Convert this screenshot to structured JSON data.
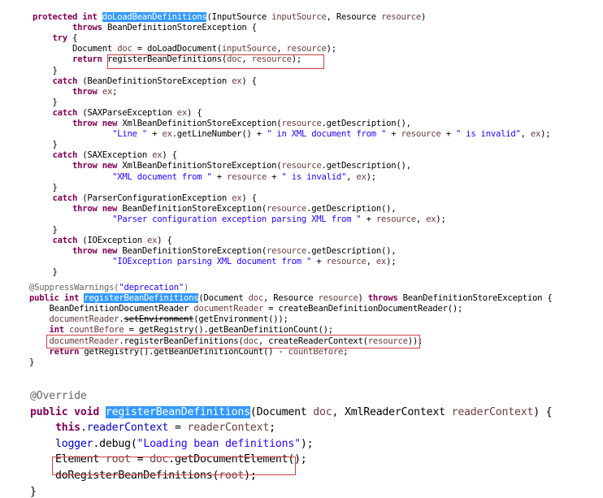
{
  "block1": {
    "lines": [
      [
        [
          "kw",
          "protected int "
        ],
        [
          "sel",
          "doLoadBeanDefinitions"
        ],
        [
          "",
          "(InputSource "
        ],
        [
          "var",
          "inputSource"
        ],
        [
          "",
          ", Resource "
        ],
        [
          "var",
          "resource"
        ],
        [
          "",
          ")"
        ]
      ],
      [
        [
          "",
          "        "
        ],
        [
          "kw",
          "throws"
        ],
        [
          "",
          " BeanDefinitionStoreException {"
        ]
      ],
      [
        [
          "",
          "    "
        ],
        [
          "kw",
          "try"
        ],
        [
          "",
          " {"
        ]
      ],
      [
        [
          "",
          "        Document "
        ],
        [
          "var",
          "doc"
        ],
        [
          "",
          " = doLoadDocument("
        ],
        [
          "var",
          "inputSource"
        ],
        [
          "",
          ", "
        ],
        [
          "var",
          "resource"
        ],
        [
          "",
          ");"
        ]
      ],
      [
        [
          "",
          "        "
        ],
        [
          "kw",
          "return"
        ],
        [
          "",
          " registerBeanDefinitions("
        ],
        [
          "var",
          "doc"
        ],
        [
          "",
          ", "
        ],
        [
          "var",
          "resource"
        ],
        [
          "",
          ");"
        ]
      ],
      [
        [
          "",
          "    }"
        ]
      ],
      [
        [
          "",
          "    "
        ],
        [
          "kw",
          "catch"
        ],
        [
          "",
          " (BeanDefinitionStoreException "
        ],
        [
          "var",
          "ex"
        ],
        [
          "",
          ") {"
        ]
      ],
      [
        [
          "",
          "        "
        ],
        [
          "kw",
          "throw"
        ],
        [
          "",
          " "
        ],
        [
          "var",
          "ex"
        ],
        [
          "",
          ";"
        ]
      ],
      [
        [
          "",
          "    }"
        ]
      ],
      [
        [
          "",
          "    "
        ],
        [
          "kw",
          "catch"
        ],
        [
          "",
          " (SAXParseException "
        ],
        [
          "var",
          "ex"
        ],
        [
          "",
          ") {"
        ]
      ],
      [
        [
          "",
          "        "
        ],
        [
          "kw",
          "throw new"
        ],
        [
          "",
          " XmlBeanDefinitionStoreException("
        ],
        [
          "var",
          "resource"
        ],
        [
          "",
          ".getDescription(),"
        ]
      ],
      [
        [
          "",
          "                "
        ],
        [
          "str",
          "\"Line \""
        ],
        [
          "",
          " + "
        ],
        [
          "var",
          "ex"
        ],
        [
          "",
          ".getLineNumber() + "
        ],
        [
          "str",
          "\" in XML document from \""
        ],
        [
          "",
          " + "
        ],
        [
          "var",
          "resource"
        ],
        [
          "",
          " + "
        ],
        [
          "str",
          "\" is invalid\""
        ],
        [
          "",
          ", "
        ],
        [
          "var",
          "ex"
        ],
        [
          "",
          ");"
        ]
      ],
      [
        [
          "",
          "    }"
        ]
      ],
      [
        [
          "",
          "    "
        ],
        [
          "kw",
          "catch"
        ],
        [
          "",
          " (SAXException "
        ],
        [
          "var",
          "ex"
        ],
        [
          "",
          ") {"
        ]
      ],
      [
        [
          "",
          "        "
        ],
        [
          "kw",
          "throw new"
        ],
        [
          "",
          " XmlBeanDefinitionStoreException("
        ],
        [
          "var",
          "resource"
        ],
        [
          "",
          ".getDescription(),"
        ]
      ],
      [
        [
          "",
          "                "
        ],
        [
          "str",
          "\"XML document from \""
        ],
        [
          "",
          " + "
        ],
        [
          "var",
          "resource"
        ],
        [
          "",
          " + "
        ],
        [
          "str",
          "\" is invalid\""
        ],
        [
          "",
          ", "
        ],
        [
          "var",
          "ex"
        ],
        [
          "",
          ");"
        ]
      ],
      [
        [
          "",
          "    }"
        ]
      ],
      [
        [
          "",
          "    "
        ],
        [
          "kw",
          "catch"
        ],
        [
          "",
          " (ParserConfigurationException "
        ],
        [
          "var",
          "ex"
        ],
        [
          "",
          ") {"
        ]
      ],
      [
        [
          "",
          "        "
        ],
        [
          "kw",
          "throw new"
        ],
        [
          "",
          " BeanDefinitionStoreException("
        ],
        [
          "var",
          "resource"
        ],
        [
          "",
          ".getDescription(),"
        ]
      ],
      [
        [
          "",
          "                "
        ],
        [
          "str",
          "\"Parser configuration exception parsing XML from \""
        ],
        [
          "",
          " + "
        ],
        [
          "var",
          "resource"
        ],
        [
          "",
          ", "
        ],
        [
          "var",
          "ex"
        ],
        [
          "",
          ");"
        ]
      ],
      [
        [
          "",
          "    }"
        ]
      ],
      [
        [
          "",
          "    "
        ],
        [
          "kw",
          "catch"
        ],
        [
          "",
          " (IOException "
        ],
        [
          "var",
          "ex"
        ],
        [
          "",
          ") {"
        ]
      ],
      [
        [
          "",
          "        "
        ],
        [
          "kw",
          "throw new"
        ],
        [
          "",
          " BeanDefinitionStoreException("
        ],
        [
          "var",
          "resource"
        ],
        [
          "",
          ".getDescription(),"
        ]
      ],
      [
        [
          "",
          "                "
        ],
        [
          "str",
          "\"IOException parsing XML document from \""
        ],
        [
          "",
          " + "
        ],
        [
          "var",
          "resource"
        ],
        [
          "",
          ", "
        ],
        [
          "var",
          "ex"
        ],
        [
          "",
          ");"
        ]
      ],
      [
        [
          "",
          "    }"
        ]
      ]
    ]
  },
  "block2": {
    "lines": [
      [
        [
          "ann",
          "@SuppressWarnings("
        ],
        [
          "str",
          "\"deprecation\""
        ],
        [
          "ann",
          ")"
        ]
      ],
      [
        [
          "kw",
          "public int "
        ],
        [
          "sel",
          "registerBeanDefinitions"
        ],
        [
          "",
          "(Document "
        ],
        [
          "var",
          "doc"
        ],
        [
          "",
          ", Resource "
        ],
        [
          "var",
          "resource"
        ],
        [
          "",
          ") "
        ],
        [
          "kw",
          "throws"
        ],
        [
          "",
          " BeanDefinitionStoreException {"
        ]
      ],
      [
        [
          "",
          "    BeanDefinitionDocumentReader "
        ],
        [
          "var",
          "documentReader"
        ],
        [
          "",
          " = createBeanDefinitionDocumentReader();"
        ]
      ],
      [
        [
          "",
          "    "
        ],
        [
          "var",
          "documentReader"
        ],
        [
          "",
          "."
        ],
        [
          "strike",
          "setEnvironment"
        ],
        [
          "",
          "(getEnvironment());"
        ]
      ],
      [
        [
          "",
          "    "
        ],
        [
          "kw",
          "int"
        ],
        [
          "",
          " "
        ],
        [
          "var",
          "countBefore"
        ],
        [
          "",
          " = getRegistry().getBeanDefinitionCount();"
        ]
      ],
      [
        [
          "",
          "    "
        ],
        [
          "var",
          "documentReader"
        ],
        [
          "",
          ".registerBeanDefinitions("
        ],
        [
          "var",
          "doc"
        ],
        [
          "",
          ", createReaderContext("
        ],
        [
          "var",
          "resource"
        ],
        [
          "",
          "));"
        ]
      ],
      [
        [
          "",
          "    "
        ],
        [
          "kw",
          "return"
        ],
        [
          "",
          " getRegistry().getBeanDefinitionCount() - "
        ],
        [
          "var",
          "countBefore"
        ],
        [
          "",
          ";"
        ]
      ],
      [
        [
          "",
          "}"
        ]
      ]
    ]
  },
  "block3": {
    "lines": [
      [
        [
          "ann",
          "@Override"
        ]
      ],
      [
        [
          "kw",
          "public void "
        ],
        [
          "sel",
          "registerBeanDefinitions"
        ],
        [
          "",
          "(Document "
        ],
        [
          "var",
          "doc"
        ],
        [
          "",
          ", XmlReaderContext "
        ],
        [
          "var",
          "readerContext"
        ],
        [
          "",
          ") {"
        ]
      ],
      [
        [
          "",
          "    "
        ],
        [
          "kw",
          "this"
        ],
        [
          "",
          "."
        ],
        [
          "fld",
          "readerContext"
        ],
        [
          "",
          " = "
        ],
        [
          "var",
          "readerContext"
        ],
        [
          "",
          ";"
        ]
      ],
      [
        [
          "",
          "    "
        ],
        [
          "fld",
          "logger"
        ],
        [
          "",
          ".debug("
        ],
        [
          "str",
          "\"Loading bean definitions\""
        ],
        [
          "",
          ");"
        ]
      ],
      [
        [
          "",
          "    Element "
        ],
        [
          "var",
          "root"
        ],
        [
          "",
          " = "
        ],
        [
          "var",
          "doc"
        ],
        [
          "",
          ".getDocumentElement();"
        ]
      ],
      [
        [
          "",
          "    doRegisterBeanDefinitions("
        ],
        [
          "var",
          "root"
        ],
        [
          "",
          ");"
        ]
      ],
      [
        [
          "",
          "}"
        ]
      ]
    ]
  }
}
